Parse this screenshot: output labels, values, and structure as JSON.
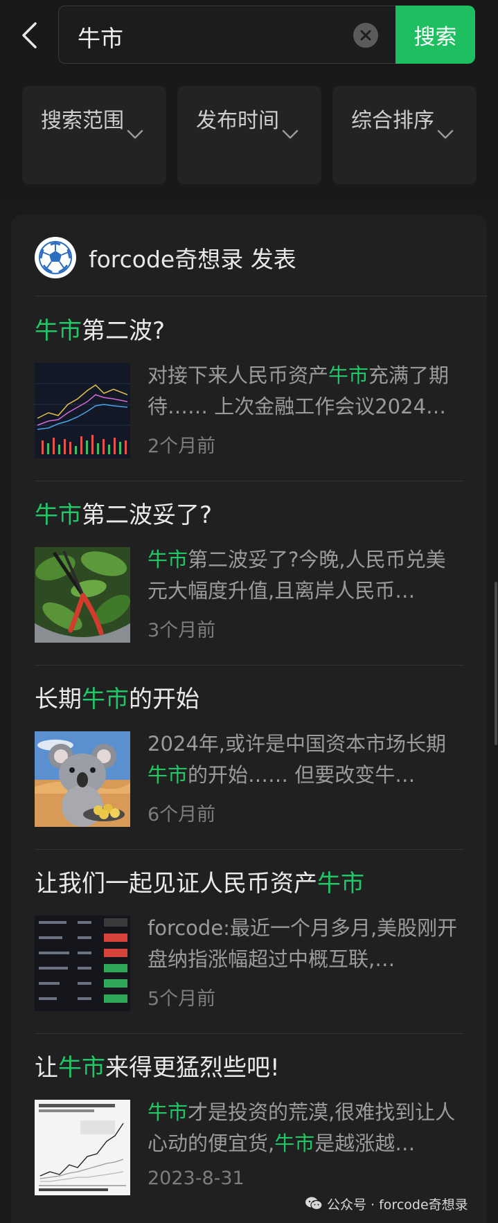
{
  "search": {
    "query": "牛市",
    "button_label": "搜索"
  },
  "filters": [
    {
      "label": "搜索范围"
    },
    {
      "label": "发布时间"
    },
    {
      "label": "综合排序"
    }
  ],
  "author": {
    "name": "forcode奇想录 发表"
  },
  "colors": {
    "accent": "#1dbf61",
    "highlight": "#1fc766",
    "background": "#1a1a1a",
    "card": "#202020"
  },
  "results": [
    {
      "title_parts": [
        {
          "text": "牛市",
          "hl": true
        },
        {
          "text": "第二波?",
          "hl": false
        }
      ],
      "snippet_parts": [
        {
          "text": "对接下来人民币资产",
          "hl": false
        },
        {
          "text": "牛市",
          "hl": true
        },
        {
          "text": "充满了期待…… 上次金融工作会议2024…",
          "hl": false
        }
      ],
      "date": "2个月前",
      "thumb_icon": "stock-chart-icon"
    },
    {
      "title_parts": [
        {
          "text": "牛市",
          "hl": true
        },
        {
          "text": "第二波妥了?",
          "hl": false
        }
      ],
      "snippet_parts": [
        {
          "text": "牛市",
          "hl": true
        },
        {
          "text": "第二波妥了?今晚,人民币兑美元大幅度升值,且离岸人民币…",
          "hl": false
        }
      ],
      "date": "3个月前",
      "thumb_icon": "scissors-leaves-photo"
    },
    {
      "title_parts": [
        {
          "text": "长期",
          "hl": false
        },
        {
          "text": "牛市",
          "hl": true
        },
        {
          "text": "的开始",
          "hl": false
        }
      ],
      "snippet_parts": [
        {
          "text": "2024年,或许是中国资本市场长期",
          "hl": false
        },
        {
          "text": "牛市",
          "hl": true
        },
        {
          "text": "的开始…… 但要改变牛…",
          "hl": false
        }
      ],
      "date": "6个月前",
      "thumb_icon": "koala-desert-photo"
    },
    {
      "title_parts": [
        {
          "text": "让我们一起见证人民币资产",
          "hl": false
        },
        {
          "text": "牛市",
          "hl": true
        }
      ],
      "snippet_parts": [
        {
          "text": "forcode:最近一个月多月,美股刚开盘纳指涨幅超过中概互联,…",
          "hl": false
        }
      ],
      "date": "5个月前",
      "thumb_icon": "stock-list-icon"
    },
    {
      "title_parts": [
        {
          "text": "让",
          "hl": false
        },
        {
          "text": "牛市",
          "hl": true
        },
        {
          "text": "来得更猛烈些吧!",
          "hl": false
        }
      ],
      "snippet_parts": [
        {
          "text": "牛市",
          "hl": true
        },
        {
          "text": "才是投资的荒漠,很难找到让人心动的便宜货,",
          "hl": false
        },
        {
          "text": "牛市",
          "hl": true
        },
        {
          "text": "是越涨越…",
          "hl": false
        }
      ],
      "date": "2023-8-31",
      "thumb_icon": "line-chart-icon"
    }
  ],
  "watermark": {
    "text": "公众号 · forcode奇想录"
  }
}
